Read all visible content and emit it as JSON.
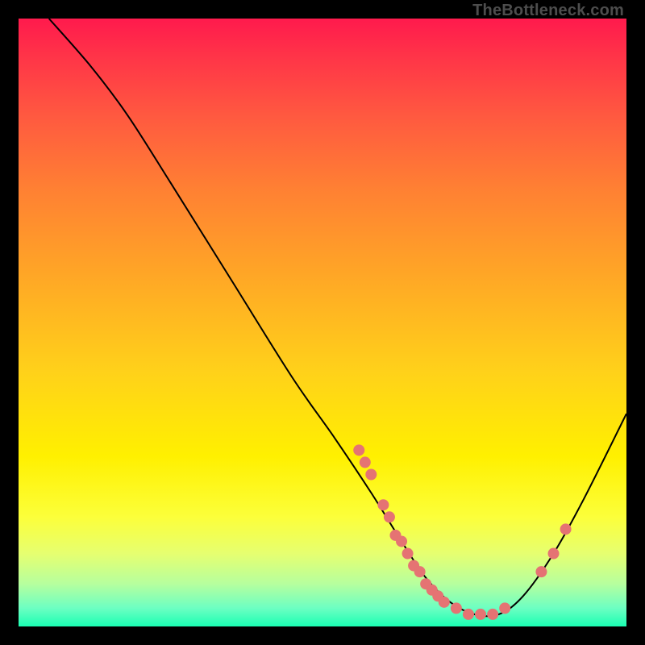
{
  "watermark": "TheBottleneck.com",
  "chart_data": {
    "type": "line",
    "title": "",
    "xlabel": "",
    "ylabel": "",
    "xlim": [
      0,
      100
    ],
    "ylim": [
      0,
      100
    ],
    "curve": [
      {
        "x": 5,
        "y": 100
      },
      {
        "x": 12,
        "y": 92
      },
      {
        "x": 18,
        "y": 84
      },
      {
        "x": 25,
        "y": 73
      },
      {
        "x": 35,
        "y": 57
      },
      {
        "x": 45,
        "y": 41
      },
      {
        "x": 52,
        "y": 31
      },
      {
        "x": 58,
        "y": 22
      },
      {
        "x": 63,
        "y": 14
      },
      {
        "x": 67,
        "y": 8
      },
      {
        "x": 71,
        "y": 4
      },
      {
        "x": 75,
        "y": 2
      },
      {
        "x": 79,
        "y": 2
      },
      {
        "x": 83,
        "y": 5
      },
      {
        "x": 88,
        "y": 12
      },
      {
        "x": 93,
        "y": 21
      },
      {
        "x": 100,
        "y": 35
      }
    ],
    "points": [
      {
        "x": 56,
        "y": 29
      },
      {
        "x": 57,
        "y": 27
      },
      {
        "x": 58,
        "y": 25
      },
      {
        "x": 60,
        "y": 20
      },
      {
        "x": 61,
        "y": 18
      },
      {
        "x": 62,
        "y": 15
      },
      {
        "x": 63,
        "y": 14
      },
      {
        "x": 64,
        "y": 12
      },
      {
        "x": 65,
        "y": 10
      },
      {
        "x": 66,
        "y": 9
      },
      {
        "x": 67,
        "y": 7
      },
      {
        "x": 68,
        "y": 6
      },
      {
        "x": 69,
        "y": 5
      },
      {
        "x": 70,
        "y": 4
      },
      {
        "x": 72,
        "y": 3
      },
      {
        "x": 74,
        "y": 2
      },
      {
        "x": 76,
        "y": 2
      },
      {
        "x": 78,
        "y": 2
      },
      {
        "x": 80,
        "y": 3
      },
      {
        "x": 86,
        "y": 9
      },
      {
        "x": 88,
        "y": 12
      },
      {
        "x": 90,
        "y": 16
      }
    ],
    "colors": {
      "dot": "#e57373",
      "curve": "#000000"
    }
  }
}
